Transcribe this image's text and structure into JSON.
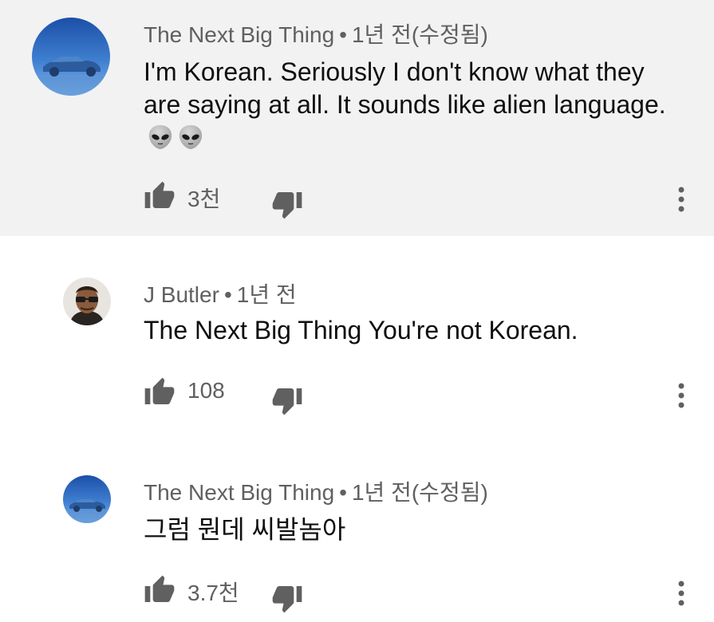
{
  "comments": [
    {
      "author": "The Next Big Thing",
      "separator": "•",
      "time": "1년 전(수정됨)",
      "text": "I'm Korean. Seriously I don't know what they are saying at all.  It sounds like alien language.",
      "emoji": [
        "alien-face-emoji",
        "alien-face-emoji"
      ],
      "likes": "3천",
      "avatar_icon": "car-avatar",
      "highlighted": true
    },
    {
      "author": "J Butler",
      "separator": "•",
      "time": "1년 전",
      "text": "The Next Big Thing You're not Korean.",
      "likes": "108",
      "avatar_icon": "person-avatar",
      "highlighted": false
    },
    {
      "author": "The Next Big Thing",
      "separator": "•",
      "time": "1년 전(수정됨)",
      "text": "그럼 뭔데 씨발놈아",
      "likes": "3.7천",
      "avatar_icon": "car-avatar",
      "highlighted": false
    }
  ],
  "icons": {
    "like": "thumb-up-icon",
    "dislike": "thumb-down-icon",
    "more": "more-vert-icon"
  },
  "colors": {
    "highlight_bg": "#f2f2f2",
    "meta_text": "#606060",
    "body_text": "#0f0f0f",
    "icon": "#606060"
  }
}
